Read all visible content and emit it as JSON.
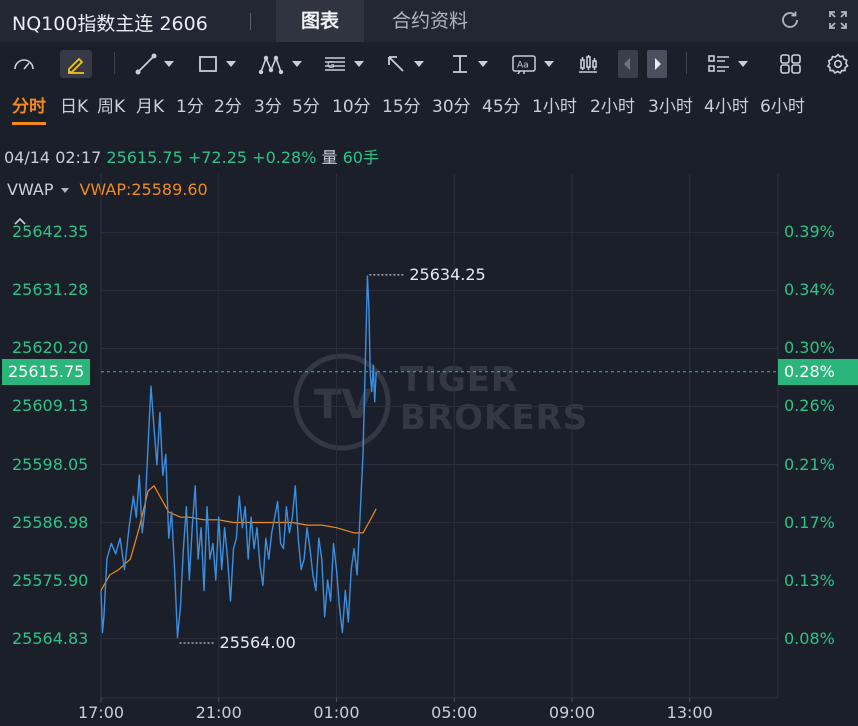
{
  "header": {
    "title": "NQ100指数主连 2606",
    "tabs": [
      {
        "label": "图表",
        "active": true
      },
      {
        "label": "合约资料",
        "active": false
      }
    ],
    "refresh_icon": "refresh-icon",
    "fullscreen_icon": "fullscreen-icon"
  },
  "toolbar": {
    "tools": [
      "speedometer-icon",
      "pencil-icon",
      "line-tool-icon",
      "rectangle-tool-icon",
      "pattern-tool-icon",
      "fibonacci-tool-icon",
      "arrow-tool-icon",
      "measure-tool-icon",
      "text-tool-icon",
      "candlestick-icon",
      "prev-icon",
      "next-icon",
      "layout-list-icon",
      "grid-icon",
      "gear-icon"
    ]
  },
  "periods": [
    "分时",
    "日K",
    "周K",
    "月K",
    "1分",
    "2分",
    "3分",
    "5分",
    "10分",
    "15分",
    "30分",
    "45分",
    "1小时",
    "2小时",
    "3小时",
    "4小时",
    "6小时"
  ],
  "active_period": "分时",
  "info": {
    "datetime": "04/14 02:17",
    "price": "25615.75",
    "change": "+72.25",
    "change_pct": "+0.28%",
    "volume_label": "量",
    "volume": "60手"
  },
  "indicator": {
    "name": "VWAP",
    "value": "VWAP:25589.60"
  },
  "watermark": {
    "line1": "TIGER",
    "line2": "BROKERS"
  },
  "colors": {
    "background": "#1b1f2a",
    "price_line": "#3b8fe0",
    "vwap_line": "#f38a1c",
    "positive": "#2cc384",
    "current_price_box": "#2ab57a",
    "active_period": "#f38a1c"
  },
  "chart_data": {
    "type": "line",
    "y_left_ticks": [
      "25642.35",
      "25631.28",
      "25620.20",
      "25609.13",
      "25598.05",
      "25586.98",
      "25575.90",
      "25564.83"
    ],
    "y_right_ticks": [
      "0.39%",
      "0.34%",
      "0.30%",
      "0.26%",
      "0.21%",
      "0.17%",
      "0.13%",
      "0.08%"
    ],
    "x_ticks": [
      "17:00",
      "21:00",
      "01:00",
      "05:00",
      "09:00",
      "13:00"
    ],
    "current_price": "25615.75",
    "current_pct": "0.28%",
    "high_label": "25634.25",
    "low_label": "25564.00",
    "ylim": [
      25553.5,
      25653.5
    ],
    "x_range_hours": [
      0,
      23
    ],
    "series": [
      {
        "x": [
          0.0,
          0.05,
          0.1,
          0.2,
          0.35,
          0.5,
          0.65,
          0.8,
          0.95,
          1.1,
          1.2,
          1.3,
          1.4,
          1.5,
          1.6,
          1.7,
          1.8,
          1.9,
          2.0,
          2.1,
          2.2,
          2.3,
          2.4,
          2.5,
          2.6,
          2.7,
          2.8,
          2.9,
          3.0,
          3.1,
          3.2,
          3.3,
          3.4,
          3.5,
          3.6,
          3.7,
          3.8,
          3.9,
          4.0,
          4.1,
          4.2,
          4.3,
          4.4,
          4.5,
          4.6,
          4.7,
          4.8,
          4.9,
          5.0,
          5.1,
          5.2,
          5.3,
          5.4,
          5.5,
          5.6,
          5.7,
          5.8,
          5.9,
          6.0,
          6.1,
          6.2,
          6.3,
          6.4,
          6.5,
          6.6,
          6.7,
          6.8,
          6.9,
          7.0,
          7.1,
          7.2,
          7.3,
          7.4,
          7.5,
          7.6,
          7.7,
          7.8,
          7.9,
          8.0,
          8.1,
          8.2,
          8.3,
          8.4,
          8.5,
          8.6,
          8.7,
          8.8,
          8.9,
          9.0,
          9.05,
          9.1,
          9.15,
          9.2,
          9.25,
          9.3,
          9.35
        ],
        "values": [
          25574,
          25566,
          25569,
          25580,
          25583,
          25581,
          25584,
          25578,
          25586,
          25592,
          25588,
          25596,
          25585,
          25590,
          25602,
          25613,
          25605,
          25598,
          25608,
          25596,
          25600,
          25584,
          25589,
          25578,
          25565,
          25571,
          25582,
          25590,
          25576,
          25586,
          25594,
          25580,
          25586,
          25574,
          25590,
          25580,
          25583,
          25576,
          25588,
          25578,
          25586,
          25580,
          25572,
          25582,
          25584,
          25592,
          25586,
          25590,
          25580,
          25588,
          25582,
          25586,
          25579,
          25575,
          25584,
          25580,
          25585,
          25588,
          25591,
          25583,
          25582,
          25590,
          25585,
          25588,
          25594,
          25584,
          25578,
          25580,
          25586,
          25582,
          25577,
          25574,
          25584,
          25580,
          25569,
          25576,
          25572,
          25583,
          25578,
          25571,
          25566,
          25574,
          25568,
          25578,
          25582,
          25577,
          25588,
          25600,
          25622,
          25634,
          25628,
          25615,
          25612,
          25617,
          25610,
          25615.75
        ]
      },
      {
        "x": [
          0.0,
          0.1,
          0.3,
          0.6,
          1.0,
          1.3,
          1.6,
          1.8,
          2.0,
          2.3,
          2.7,
          3.0,
          3.5,
          4.0,
          4.5,
          5.0,
          5.5,
          6.0,
          6.5,
          7.0,
          7.5,
          8.0,
          8.3,
          8.6,
          8.9,
          9.1,
          9.35
        ],
        "values": [
          25574,
          25575,
          25577,
          25578,
          25580,
          25586,
          25593,
          25594,
          25592,
          25589,
          25588,
          25588,
          25587.5,
          25587.5,
          25587,
          25587,
          25587,
          25587,
          25587,
          25586.5,
          25586.5,
          25586,
          25585.5,
          25585,
          25585,
          25587,
          25589.6
        ]
      }
    ]
  }
}
